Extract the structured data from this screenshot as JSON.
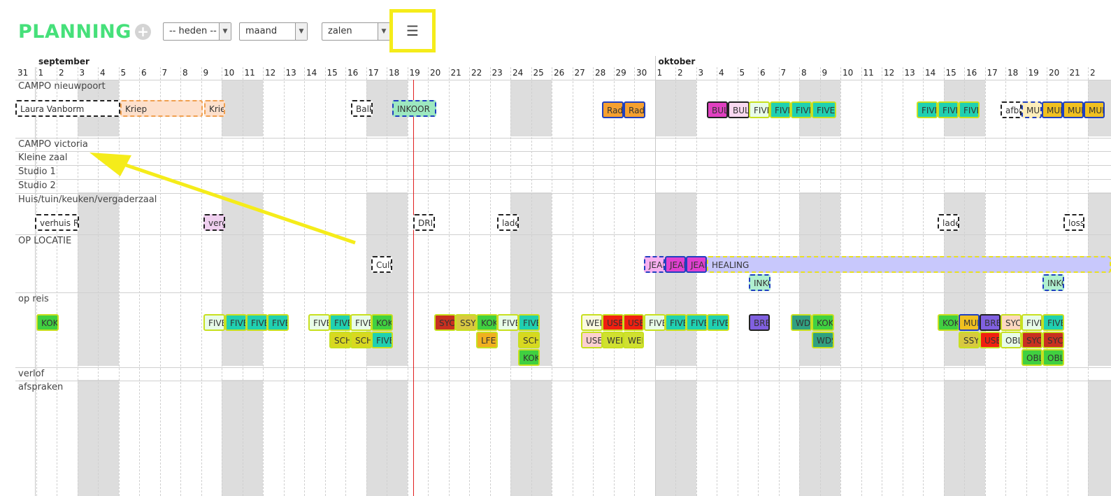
{
  "app": {
    "title": "PLANNING",
    "add_icon": "plus-circle-icon",
    "filters": {
      "period_select": "-- heden --",
      "view_select": "maand",
      "group_select": "zalen"
    },
    "menu_icon": "hamburger-menu-icon"
  },
  "timeline": {
    "months": [
      "september",
      "oktober"
    ],
    "days": [
      "31",
      "1",
      "2",
      "3",
      "4",
      "5",
      "6",
      "7",
      "8",
      "9",
      "10",
      "11",
      "12",
      "13",
      "14",
      "15",
      "16",
      "17",
      "18",
      "19",
      "20",
      "21",
      "22",
      "23",
      "24",
      "25",
      "26",
      "27",
      "28",
      "29",
      "30",
      "1",
      "2",
      "3",
      "4",
      "5",
      "6",
      "7",
      "8",
      "9",
      "10",
      "11",
      "12",
      "13",
      "14",
      "15",
      "16",
      "17",
      "18",
      "19",
      "20",
      "21",
      "2"
    ]
  },
  "lanes": [
    "CAMPO nieuwpoort",
    "CAMPO victoria",
    "Kleine zaal",
    "Studio 1",
    "Studio 2",
    "Huis/tuin/keuken/vergaderzaal",
    "OP LOCATIE",
    "op reis",
    "verlof",
    "afspraken"
  ],
  "events": [
    {
      "label": "Laura Vanborm",
      "color": "#ffffff",
      "border": "#222222"
    },
    {
      "label": "Kriep",
      "color": "#fde0cc",
      "border": "#f0a050"
    },
    {
      "label": "Krie",
      "color": "#fde0cc",
      "border": "#f0a050"
    },
    {
      "label": "Balk",
      "color": "#ffffff",
      "border": "#222222"
    },
    {
      "label": "INKOOR",
      "color": "#9de8c0",
      "border": "#2040c0"
    },
    {
      "label": "Rad",
      "color": "#f5a030",
      "border": "#2040c0"
    },
    {
      "label": "Rad",
      "color": "#f5a030",
      "border": "#2040c0"
    },
    {
      "label": "BUL",
      "color": "#e040c0",
      "border": "#222222"
    },
    {
      "label": "BUL",
      "color": "#f8d8f0",
      "border": "#222222"
    },
    {
      "label": "FIVE",
      "color": "#e8fce8",
      "border": "#c8e020"
    },
    {
      "label": "FIVE",
      "color": "#20d0b0",
      "border": "#c8e020"
    },
    {
      "label": "FIVE",
      "color": "#20d0b0",
      "border": "#c8e020"
    },
    {
      "label": "FIVE",
      "color": "#20d0b0",
      "border": "#c8e020"
    },
    {
      "label": "FIVE",
      "color": "#20d0b0",
      "border": "#c8e020"
    },
    {
      "label": "FIVE",
      "color": "#20d0b0",
      "border": "#c8e020"
    },
    {
      "label": "FIVE",
      "color": "#20d0b0",
      "border": "#c8e020"
    },
    {
      "label": "afbr",
      "color": "#ffffff",
      "border": "#222222"
    },
    {
      "label": "MUL",
      "color": "#fdeebb",
      "border": "#2040c0"
    },
    {
      "label": "MUL",
      "color": "#f0c020",
      "border": "#2040c0"
    },
    {
      "label": "MUL",
      "color": "#f0c020",
      "border": "#2040c0"
    },
    {
      "label": "MUL",
      "color": "#f0c020",
      "border": "#2040c0"
    },
    {
      "label": "verhuis R",
      "color": "#ffffff",
      "border": "#222222"
    },
    {
      "label": "verg",
      "color": "#f0d0f0",
      "border": "#222222"
    },
    {
      "label": "DRIE",
      "color": "#ffffff",
      "border": "#222222"
    },
    {
      "label": "lade",
      "color": "#ffffff",
      "border": "#222222"
    },
    {
      "label": "lade",
      "color": "#ffffff",
      "border": "#222222"
    },
    {
      "label": "loss",
      "color": "#ffffff",
      "border": "#222222"
    },
    {
      "label": "Cult",
      "color": "#ffffff",
      "border": "#222222"
    },
    {
      "label": "JEAN",
      "color": "#f8b0f0",
      "border": "#2040c0"
    },
    {
      "label": "JEAN",
      "color": "#e040d0",
      "border": "#2040c0"
    },
    {
      "label": "JEAN",
      "color": "#e040d0",
      "border": "#2040c0"
    },
    {
      "label": "HEALING",
      "color": "#c8c8fc",
      "border": "#e8e020"
    },
    {
      "label": "INKO",
      "color": "#b0f0d0",
      "border": "#2040c0"
    },
    {
      "label": "INKO",
      "color": "#b0f0d0",
      "border": "#2040c0"
    },
    {
      "label": "KOK",
      "color": "#40d040",
      "border": "#c8e020"
    },
    {
      "label": "FIVE",
      "color": "#e8fce8",
      "border": "#c8e020"
    },
    {
      "label": "FIVE",
      "color": "#20d0b0",
      "border": "#c8e020"
    },
    {
      "label": "FIVE",
      "color": "#20d0b0",
      "border": "#c8e020"
    },
    {
      "label": "FIVE",
      "color": "#20d0b0",
      "border": "#c8e020"
    },
    {
      "label": "FIVE",
      "color": "#e8fce8",
      "border": "#c8e020"
    },
    {
      "label": "FIVE",
      "color": "#20d0b0",
      "border": "#c8e020"
    },
    {
      "label": "FIVE",
      "color": "#e8fce8",
      "border": "#c8e020"
    },
    {
      "label": "KOK",
      "color": "#40d040",
      "border": "#c8e020"
    },
    {
      "label": "SCH",
      "color": "#d8d820",
      "border": "#c8e020"
    },
    {
      "label": "SCH",
      "color": "#d8d820",
      "border": "#c8e020"
    },
    {
      "label": "FIVE",
      "color": "#20d0b0",
      "border": "#c8e020"
    },
    {
      "label": "SYC",
      "color": "#c83020",
      "border": "#c8e020"
    },
    {
      "label": "SSY",
      "color": "#d8c840",
      "border": "#c8e020"
    },
    {
      "label": "KOK",
      "color": "#40d040",
      "border": "#c8e020"
    },
    {
      "label": "FIVE",
      "color": "#e8fce8",
      "border": "#c8e020"
    },
    {
      "label": "FIVE",
      "color": "#20d0b0",
      "border": "#c8e020"
    },
    {
      "label": "LFEC",
      "color": "#f0b020",
      "border": "#c8e020"
    },
    {
      "label": "SCH",
      "color": "#d8d820",
      "border": "#c8e020"
    },
    {
      "label": "KOK",
      "color": "#40d040",
      "border": "#c8e020"
    },
    {
      "label": "WEI",
      "color": "#fafae0",
      "border": "#c8e020"
    },
    {
      "label": "USE",
      "color": "#f02010",
      "border": "#c8e020"
    },
    {
      "label": "USE",
      "color": "#f02010",
      "border": "#c8e020"
    },
    {
      "label": "FIVE",
      "color": "#e8fce8",
      "border": "#c8e020"
    },
    {
      "label": "FIVE",
      "color": "#20d0b0",
      "border": "#c8e020"
    },
    {
      "label": "FIVE",
      "color": "#20d0b0",
      "border": "#c8e020"
    },
    {
      "label": "FIVE",
      "color": "#20d0b0",
      "border": "#c8e020"
    },
    {
      "label": "USE",
      "color": "#fcd0d0",
      "border": "#c8e020"
    },
    {
      "label": "WEI",
      "color": "#d0e030",
      "border": "#c8e020"
    },
    {
      "label": "WEI",
      "color": "#d0e030",
      "border": "#c8e020"
    },
    {
      "label": "BRE",
      "color": "#8060e0",
      "border": "#222222"
    },
    {
      "label": "WD",
      "color": "#30a080",
      "border": "#c8e020"
    },
    {
      "label": "KOK",
      "color": "#40d040",
      "border": "#c8e020"
    },
    {
      "label": "WDS",
      "color": "#30a080",
      "border": "#c8e020"
    },
    {
      "label": "KOK",
      "color": "#40d040",
      "border": "#c8e020"
    },
    {
      "label": "MUL",
      "color": "#f0c020",
      "border": "#2040c0"
    },
    {
      "label": "BRE",
      "color": "#8060e0",
      "border": "#222222"
    },
    {
      "label": "SYC",
      "color": "#fcd8c0",
      "border": "#c8e020"
    },
    {
      "label": "FIVE",
      "color": "#e8fce8",
      "border": "#c8e020"
    },
    {
      "label": "FIVE",
      "color": "#20d0b0",
      "border": "#c8e020"
    },
    {
      "label": "SSY",
      "color": "#d8c840",
      "border": "#c8e020"
    },
    {
      "label": "USE",
      "color": "#f02010",
      "border": "#c8e020"
    },
    {
      "label": "OBL",
      "color": "#e8fce8",
      "border": "#c8e020"
    },
    {
      "label": "SYC",
      "color": "#c83020",
      "border": "#c8e020"
    },
    {
      "label": "SYC",
      "color": "#c83020",
      "border": "#c8e020"
    },
    {
      "label": "OBL",
      "color": "#40d040",
      "border": "#c8e020"
    },
    {
      "label": "OBL",
      "color": "#40d040",
      "border": "#c8e020"
    }
  ]
}
